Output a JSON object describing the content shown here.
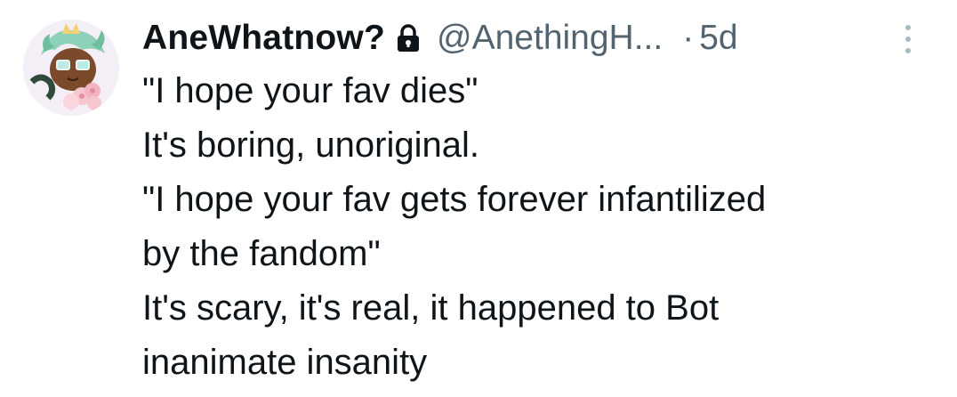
{
  "tweet": {
    "author": {
      "display_name": "AneWhatnow?",
      "handle": "@AnethingH...",
      "protected_icon": "lock-icon",
      "avatar_icon": "avatar"
    },
    "separator": "·",
    "timestamp": "5d",
    "more_icon": "more-vertical-icon",
    "lines": [
      "\"I hope your fav dies\"",
      "It's boring, unoriginal.",
      "\"I hope your fav gets forever infantilized",
      "by the fandom\"",
      "It's scary, it's real, it happened to Bot",
      "inanimate insanity"
    ]
  }
}
